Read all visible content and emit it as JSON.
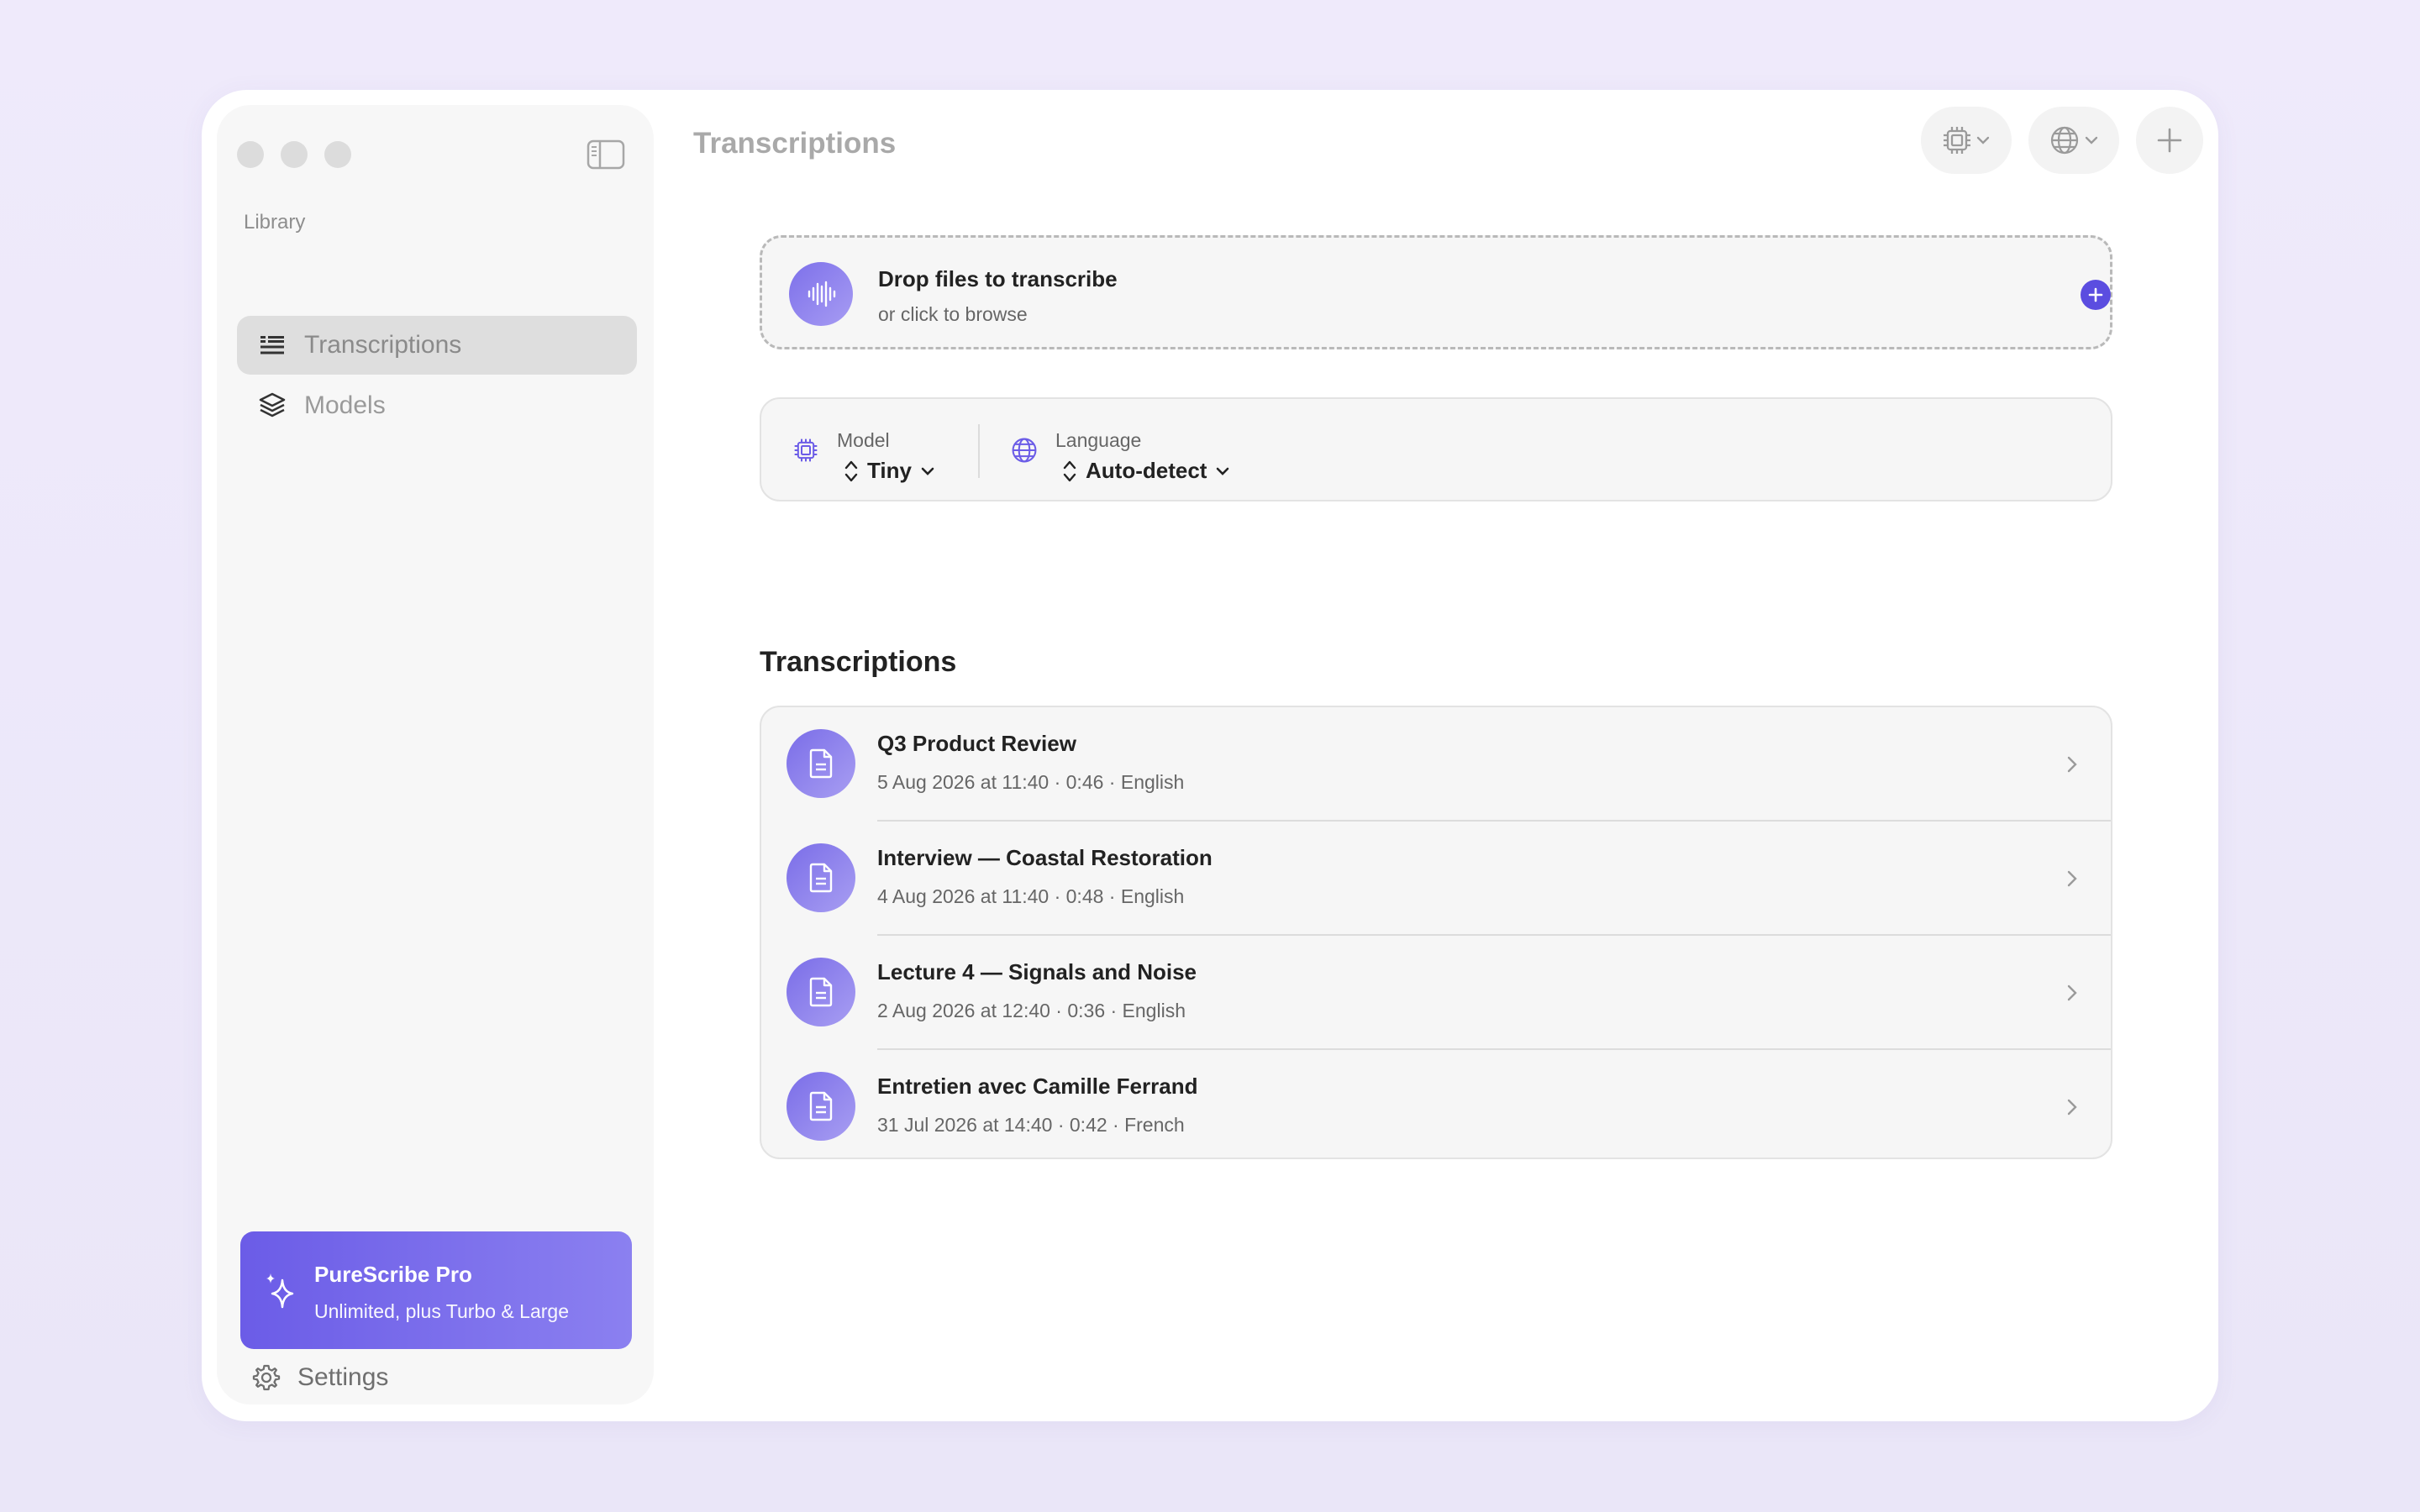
{
  "sidebar": {
    "section_label": "Library",
    "items": [
      {
        "label": "Transcriptions",
        "icon": "transcript-list-icon",
        "active": true
      },
      {
        "label": "Models",
        "icon": "layers-icon",
        "active": false
      }
    ],
    "promo": {
      "title": "PureScribe Pro",
      "subtitle": "Unlimited, plus Turbo & Large"
    },
    "settings_label": "Settings"
  },
  "header": {
    "title": "Transcriptions"
  },
  "dropzone": {
    "title": "Drop files to transcribe",
    "subtitle": "or click to browse"
  },
  "options": {
    "model": {
      "label": "Model",
      "value": "Tiny"
    },
    "language": {
      "label": "Language",
      "value": "Auto-detect"
    }
  },
  "list": {
    "heading": "Transcriptions",
    "items": [
      {
        "title": "Q3 Product Review",
        "meta": "5 Aug 2026 at 11:40 · 0:46 · English"
      },
      {
        "title": "Interview — Coastal Restoration",
        "meta": "4 Aug 2026 at 11:40 · 0:48 · English"
      },
      {
        "title": "Lecture 4 — Signals and Noise",
        "meta": "2 Aug 2026 at 12:40 · 0:36 · English"
      },
      {
        "title": "Entretien avec Camille Ferrand",
        "meta": "31 Jul 2026 at 14:40 · 0:42 · French"
      }
    ]
  },
  "colors": {
    "accent": "#5b4de0",
    "accent_light": "#a89ef2",
    "background": "#ece8f9"
  }
}
